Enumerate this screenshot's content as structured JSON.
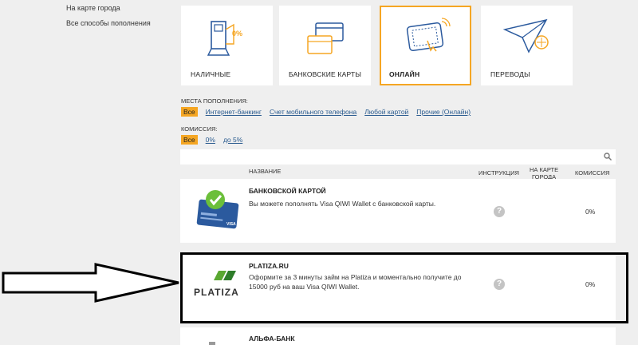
{
  "sidebar": {
    "items": [
      "На карте города",
      "Все способы пополнения"
    ]
  },
  "tiles": [
    {
      "label": "НАЛИЧНЫЕ",
      "badge": "0%"
    },
    {
      "label": "БАНКОВСКИЕ КАРТЫ"
    },
    {
      "label": "ОНЛАЙН"
    },
    {
      "label": "ПЕРЕВОДЫ"
    }
  ],
  "filters": {
    "places_title": "МЕСТА ПОПОЛНЕНИЯ:",
    "places": [
      "Все",
      "Интернет-банкинг",
      "Счет мобильного телефона",
      "Любой картой",
      "Прочие (Онлайн)"
    ],
    "commission_title": "КОМИССИЯ:",
    "commission": [
      "Все",
      "0%",
      "до 5%"
    ]
  },
  "table": {
    "headers": {
      "name": "НАЗВАНИЕ",
      "instruction": "ИНСТРУКЦИЯ",
      "map_line1": "НА КАРТЕ",
      "map_line2": "ГОРОДА",
      "commission": "КОМИССИЯ"
    },
    "rows": [
      {
        "name": "БАНКОВСКОЙ КАРТОЙ",
        "desc": "Вы можете пополнять Visa QIWI Wallet с банковской карты.",
        "help": "?",
        "fee": "0%",
        "card_text": "VISA"
      },
      {
        "name": "PLATIZA.RU",
        "desc": "Оформите за 3 минуты займ на Platiza и моментально получите до 15000 руб на ваш Visa QIWI Wallet.",
        "help": "?",
        "fee": "0%",
        "logo": "PLATIZA"
      },
      {
        "name": "АЛЬФА-БАНК"
      }
    ]
  },
  "colors": {
    "accent": "#f5a623",
    "link": "#2a5b8f",
    "icon_blue": "#2b5a9e"
  }
}
